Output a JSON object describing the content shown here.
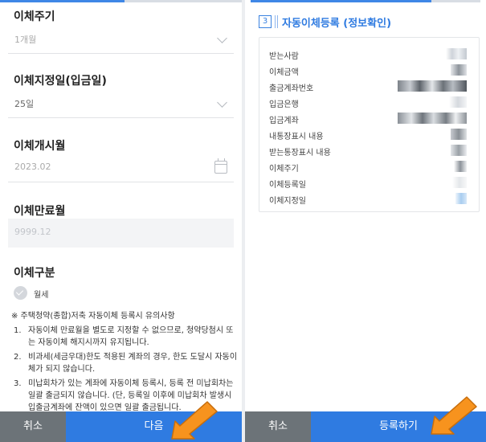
{
  "left_panel": {
    "fields": [
      {
        "label": "이체주기",
        "value": "1개월"
      },
      {
        "label": "이체지정일(입금일)",
        "value": "25일"
      },
      {
        "label": "이체개시월",
        "value": "2023.02"
      },
      {
        "label": "이체만료월",
        "value": "9999.12"
      }
    ],
    "transfer_type": {
      "label": "이체구분",
      "option": "월세"
    },
    "notice": {
      "title": "※ 주택청약(종합)저축 자동이체 등록시 유의사항",
      "items": [
        {
          "num": "1.",
          "text": "자동이체 만료월을 별도로 지정할 수 없으므로, 청약당첨시 또는 자동이체 해지시까지 유지됩니다."
        },
        {
          "num": "2.",
          "text": "비과세(세금우대)한도 적용된 계좌의 경우, 한도 도달시 자동이체가 되지 않습니다."
        },
        {
          "num": "3.",
          "text": "미납회차가 있는 계좌에 자동이체 등록시, 등록 전 미납회차는 일괄 출금되지 않습니다. (단, 등록일 이후에 미납회차 발생시 입출금계좌에 잔액이 있으면 일괄 출금됩니다."
        }
      ]
    },
    "buttons": {
      "cancel": "취소",
      "next": "다음"
    }
  },
  "right_panel": {
    "step_number": "3",
    "title": "자동이체등록 (정보확인)",
    "rows": [
      {
        "label": "받는사람"
      },
      {
        "label": "이체금액"
      },
      {
        "label": "출금계좌번호"
      },
      {
        "label": "입금은행"
      },
      {
        "label": "입금계좌"
      },
      {
        "label": "내통장표시 내용"
      },
      {
        "label": "받는통장표시 내용"
      },
      {
        "label": "이체주기"
      },
      {
        "label": "이체등록일"
      },
      {
        "label": "이체지정일"
      }
    ],
    "buttons": {
      "cancel": "취소",
      "register": "등록하기"
    }
  },
  "colors": {
    "accent": "#2f7be1",
    "cancel_button": "#6c7378",
    "pointer_arrow": "#f7931e"
  },
  "icons": {
    "select_chevron": "chevron-down-icon",
    "date_picker": "calendar-icon",
    "radio": "check-circle-icon",
    "annotation": "arrow-pointer-icon"
  }
}
